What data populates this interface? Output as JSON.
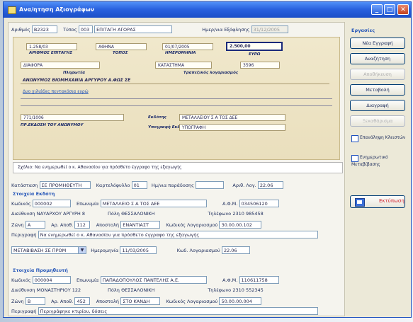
{
  "window": {
    "title": "Ανα/ητηση Αξιογράφων"
  },
  "top": {
    "arithmos_label": "Αριθμός",
    "arithmos": "Β2323",
    "typos_label": "Τύπος",
    "typos_code": "003",
    "typos_text": "ΕΠΙΤΑΓΗ ΑΓΟΡΑΣ",
    "date_label": "Ημερ/νια Εξόφλησης",
    "date": "31/12/2005"
  },
  "cheque": {
    "field1": "1.258/03",
    "field2": "ΑΘΗΝΑ",
    "field3": "01/07/2005",
    "field4": "2.500,00",
    "cap1": "ΑΡΙΘΜΟΣ ΕΠΙΤΑΓΗΣ",
    "cap2": "ΤΟΠΟΣ",
    "cap3": "ΗΜΕΡΟΜΗΝΙΑ",
    "cap4": "ΕΥΡΩ",
    "line2a": "ΔΙΑΦΟΡΑ",
    "line2b": "ΚΑΤΑΣΤΗΜΑ",
    "line2c": "3596",
    "lbl_pay": "Πληρωτέα",
    "lbl_account": "Τραπεζικός λογαριασμός",
    "pay_to": "ΑΝΩΝΥΜΟΣ ΒΙΟΜΗΧΑΝΙΑ ΑΡΓΥΡΟΥ Α.ΦΩΣ ΣΕ",
    "amount_words": "Δυο χιλιάδες πεντακόσια ευρώ",
    "code": "771/1006",
    "issuer_label": "ΠΡ.ΕΚΔΟΣΗ ΤΟΥ ΑΝΩΝΥΜΟΥ",
    "ekdotis_label": "Εκδότης",
    "ekdotis": "ΜΕΤΑΛΛΕΙΟΥ Σ Α ΤΟΣ ΔΕΕ",
    "sign_label": "Υπογραφή Εκδότη",
    "sign": "ΥΠΟΓΡΑΦΗ"
  },
  "note": "Σχόλιο: Να ενημερωθεί ο κ. Αθανασίου για πρόσθετο έγγραφο της εξαγωγής",
  "form1": {
    "katastasi_label": "Κατάσταση",
    "katastasi": "ΣΕ ΠΡΟΜΗΘΕΥΤΗ",
    "symbolaio_label": "Καρτελόφυλλο",
    "symbolaio": "01",
    "h_label": "Ημ/νια παράδοσης",
    "h_val": "",
    "ar_label": "Αριθ. Λογ.",
    "ar_val": "22.06"
  },
  "section1": "Στοιχεία Εκδότη",
  "form2": {
    "kwd_label": "Κωδικός",
    "kwd": "000002",
    "eponymia_label": "Επωνυμία",
    "eponymia": "ΜΕΤΑΛΛΕΙΟ Σ Α ΤΟΣ ΔΕΕ",
    "afm_label": "Α.Φ.Μ.",
    "afm": "034506120",
    "dieuth_label": "Διεύθυνση",
    "dieuth": "ΝΑΥΑΡΧΟΥ ΑΡΓΥΡΗ 8",
    "poli_label": "Πόλη",
    "poli": "ΘΕΣΣΑΛΟΝΙΚΗ",
    "til_label": "Τηλέφωνο",
    "til": "2310 985458",
    "zoni_label": "Ζώνη",
    "zoni": "Α",
    "arap_label": "Αρ. Αποθ.",
    "arap": "112",
    "aposteila_label": "Αποστολή",
    "aposteila": "ΕΝΑΝΤΙΑΣΤ",
    "kodik_label": "Κωδικός Λογαριασμού",
    "kodik": "30.00.00.102",
    "per_label": "Περιγραφή",
    "per": "Να ενημερωθεί ο κ. Αθανασίου για πρόσθετο έγγραφο της εξαγωγής"
  },
  "form3": {
    "sel_label": "ΜΕΤΑΒΙΒΑΣΗ ΣΕ ΠΡΟΜ",
    "hmer_label": "Ημερομηνία",
    "hmer": "11/03/2005",
    "kod_label": "Κωδ. Λογαριασμού",
    "kod": "22.06"
  },
  "section2": "Στοιχεία Προμηθευτή",
  "form4": {
    "kwd_label": "Κωδικός",
    "kwd": "000004",
    "eponymia_label": "Επωνυμία",
    "eponymia": "ΠΑΠΑΔΟΠΟΥΛΟΣ ΠΑΝΤΕΛΗΣ Α.Ε.",
    "afm_label": "Α.Φ.Μ.",
    "afm": "110611758",
    "dieuth_label": "Διεύθυνση",
    "dieuth": "ΜΟΝΑΣΤΗΡΙΟΥ 122",
    "poli_label": "Πόλη",
    "poli": "ΘΕΣΣΑΛΟΝΙΚΗ",
    "til_label": "Τηλέφωνο",
    "til": "2310 552345",
    "zoni_label": "Ζώνη",
    "zoni": "Β",
    "arap_label": "Αρ. Αποθ.",
    "arap": "452",
    "aposteila_label": "Αποστολή",
    "aposteila": "ΣΤΟ ΚΑΝΔΗ",
    "kodik_label": "Κωδικός Λογαριασμού",
    "kodik": "50.00.00.004",
    "per_label": "Περιγραφή",
    "per": "Περιγράφηκε κτιρίου, δόσεις"
  },
  "sidebar": {
    "title": "Εργασίες",
    "btn1": "Νέα Εγγραφή",
    "btn2": "Αναζήτηση",
    "btn3": "Αποθήκευση",
    "btn4": "Μεταβολή",
    "btn5": "Διαγραφή",
    "btn6": "Ξεκαθάρισμα",
    "chk1": "Επανάληψη Κλειστών",
    "chk2": "Ενημερωτικό Μεταβίβασης",
    "print": "Εκτύπωση"
  }
}
